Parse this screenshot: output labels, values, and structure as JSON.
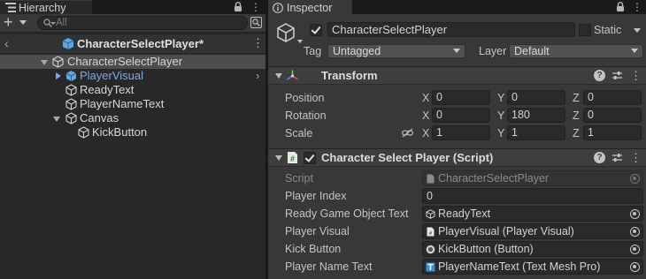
{
  "hierarchy": {
    "tab_label": "Hierarchy",
    "search_placeholder": "All",
    "scene_name": "CharacterSelectPlayer*",
    "tree": [
      {
        "label": "CharacterSelectPlayer",
        "depth": 0,
        "expanded": true,
        "selected": true,
        "prefab": false
      },
      {
        "label": "PlayerVisual",
        "depth": 1,
        "expanded": false,
        "prefab": true
      },
      {
        "label": "ReadyText",
        "depth": 1
      },
      {
        "label": "PlayerNameText",
        "depth": 1
      },
      {
        "label": "Canvas",
        "depth": 1,
        "expanded": true
      },
      {
        "label": "KickButton",
        "depth": 2
      }
    ]
  },
  "inspector": {
    "tab_label": "Inspector",
    "object": {
      "active": true,
      "name": "CharacterSelectPlayer",
      "static_label": "Static",
      "static": false,
      "tag_label": "Tag",
      "tag_value": "Untagged",
      "layer_label": "Layer",
      "layer_value": "Default"
    },
    "transform": {
      "title": "Transform",
      "position_label": "Position",
      "rotation_label": "Rotation",
      "scale_label": "Scale",
      "axis_x": "X",
      "axis_y": "Y",
      "axis_z": "Z",
      "position": {
        "x": "0",
        "y": "0",
        "z": "0"
      },
      "rotation": {
        "x": "0",
        "y": "180",
        "z": "0"
      },
      "scale": {
        "x": "1",
        "y": "1",
        "z": "1"
      }
    },
    "script_component": {
      "title": "Character Select Player (Script)",
      "enabled": true,
      "fields": [
        {
          "label": "Script",
          "value": "CharacterSelectPlayer",
          "kind": "script",
          "disabled": true
        },
        {
          "label": "Player Index",
          "value": "0",
          "kind": "number"
        },
        {
          "label": "Ready Game Object Text",
          "value": "ReadyText",
          "kind": "gameobject"
        },
        {
          "label": "Player Visual",
          "value": "PlayerVisual (Player Visual)",
          "kind": "script"
        },
        {
          "label": "Kick Button",
          "value": "KickButton (Button)",
          "kind": "button"
        },
        {
          "label": "Player Name Text",
          "value": "PlayerNameText (Text Mesh Pro)",
          "kind": "tmp"
        }
      ]
    }
  },
  "colors": {
    "selection": "#4d4d4d",
    "prefab_text": "#7ea7e8",
    "prefab_icon": "#5fa8e6"
  }
}
